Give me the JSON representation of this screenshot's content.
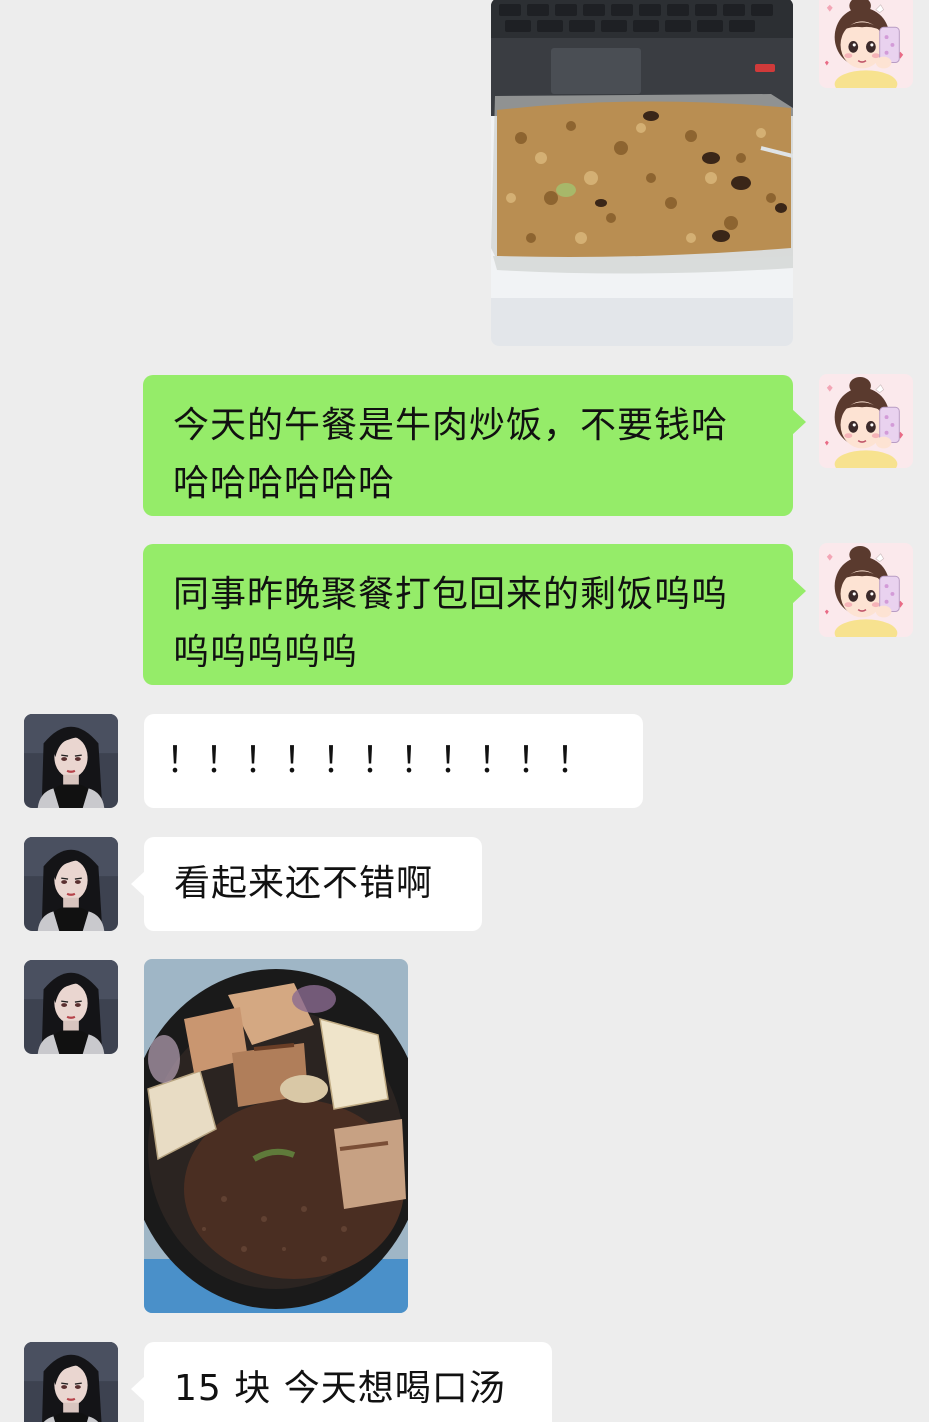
{
  "messages": [
    {
      "type": "image",
      "sender": "me",
      "image": "beef-fried-rice-on-laptop-photo"
    },
    {
      "type": "text",
      "sender": "me",
      "text": "今天的午餐是牛肉炒饭，不要钱哈哈哈哈哈哈哈"
    },
    {
      "type": "text",
      "sender": "me",
      "text": "同事昨晚聚餐打包回来的剩饭呜呜呜呜呜呜呜"
    },
    {
      "type": "text",
      "sender": "friend",
      "text": "！！！！！！！！！！！"
    },
    {
      "type": "text",
      "sender": "friend",
      "text": "看起来还不错啊"
    },
    {
      "type": "image",
      "sender": "friend",
      "image": "pork-rib-tofu-soup-photo"
    },
    {
      "type": "text",
      "sender": "friend",
      "text": "15 块 今天想喝口汤"
    }
  ],
  "colors": {
    "background": "#ededed",
    "my_bubble": "#95ec69",
    "friend_bubble": "#ffffff"
  }
}
